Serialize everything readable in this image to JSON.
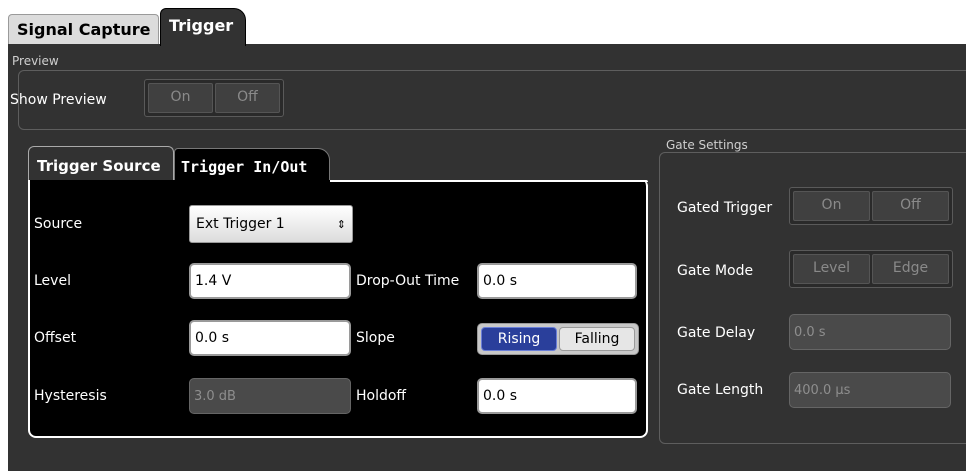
{
  "tabs": {
    "signal_capture": "Signal Capture",
    "trigger": "Trigger"
  },
  "preview": {
    "title": "Preview",
    "show_preview_label": "Show Preview",
    "on": "On",
    "off": "Off"
  },
  "sub_tabs": {
    "trigger_source": "Trigger Source",
    "trigger_in_out": "Trigger In/Out"
  },
  "trigger_source": {
    "source_label": "Source",
    "source_value": "Ext Trigger 1",
    "level_label": "Level",
    "level_value": "1.4 V",
    "dropout_label": "Drop-Out Time",
    "dropout_value": "0.0 s",
    "offset_label": "Offset",
    "offset_value": "0.0 s",
    "slope_label": "Slope",
    "slope_rising": "Rising",
    "slope_falling": "Falling",
    "slope_selected": "Rising",
    "hysteresis_label": "Hysteresis",
    "hysteresis_value": "3.0 dB",
    "holdoff_label": "Holdoff",
    "holdoff_value": "0.0 s"
  },
  "gate": {
    "title": "Gate Settings",
    "gated_trigger_label": "Gated Trigger",
    "gated_on": "On",
    "gated_off": "Off",
    "gate_mode_label": "Gate Mode",
    "mode_level": "Level",
    "mode_edge": "Edge",
    "gate_delay_label": "Gate Delay",
    "gate_delay_value": "0.0 s",
    "gate_length_label": "Gate Length",
    "gate_length_value": "400.0 µs"
  },
  "colors": {
    "panel_bg": "#323232",
    "slope_selected": "#2a3f9b"
  }
}
